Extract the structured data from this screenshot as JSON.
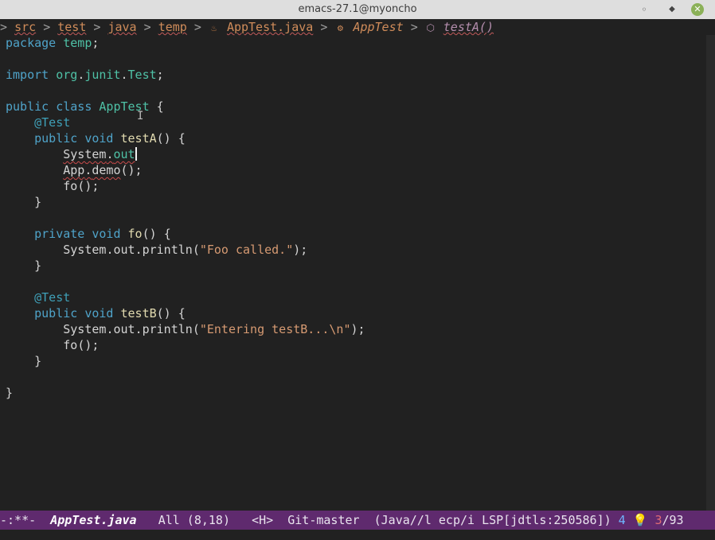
{
  "window": {
    "title": "emacs-27.1@myoncho",
    "min": "◦",
    "max": "◆",
    "close": "✕"
  },
  "breadcrumb": {
    "lead": ">",
    "sep": ">",
    "items": [
      "src",
      "test",
      "java",
      "temp"
    ],
    "file": "AppTest.java",
    "class": "AppTest",
    "method": "testA()"
  },
  "code": {
    "pkg_kw": "package",
    "pkg_name": "temp",
    "semi": ";",
    "import_kw": "import",
    "import_path_1": "org",
    "import_path_2": "junit",
    "import_class": "Test",
    "dot": ".",
    "public_kw": "public",
    "class_kw": "class",
    "class_name": "AppTest",
    "open_brace": "{",
    "close_brace": "}",
    "annotation": "@Test",
    "void_kw": "void",
    "private_kw": "private",
    "method_a": "testA",
    "method_b": "testB",
    "method_fo": "fo",
    "parens": "()",
    "system": "System",
    "out": "out",
    "println": "println",
    "app": "App",
    "demo": "demo",
    "call_end": "();",
    "str_foo": "\"Foo called.\"",
    "str_entering": "\"Entering testB...\\n\"",
    "paren_open": "(",
    "paren_close_semi": ");"
  },
  "modeline": {
    "state": "-:**-",
    "file": "AppTest.java",
    "position": "All (8,18)",
    "mode_h": "<H>",
    "vcs": "Git-master",
    "modes": "(Java//l ecp/i LSP[jdtls:250586])",
    "count": "4",
    "bulb": "💡",
    "err_count": "3",
    "total": "/93"
  },
  "colors": {
    "modeline_bg": "#5f2a6e",
    "editor_bg": "#212121",
    "keyword": "#4fa3c9",
    "type": "#4fc1a6",
    "string": "#d69a72"
  }
}
